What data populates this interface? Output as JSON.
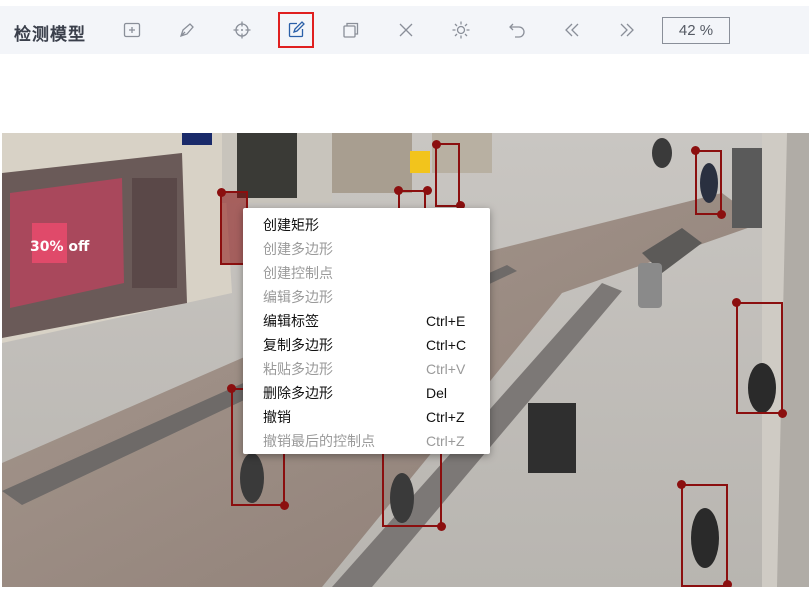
{
  "toolbar": {
    "title": "检测模型",
    "zoom": "42 %",
    "tools": [
      {
        "name": "add-box-icon",
        "active": false
      },
      {
        "name": "pen-icon",
        "active": false
      },
      {
        "name": "crosshair-icon",
        "active": false
      },
      {
        "name": "edit-icon",
        "active": true
      },
      {
        "name": "copy-icon",
        "active": false
      },
      {
        "name": "close-icon",
        "active": false
      },
      {
        "name": "brightness-icon",
        "active": false
      },
      {
        "name": "undo-icon",
        "active": false
      },
      {
        "name": "prev-icon",
        "active": false
      },
      {
        "name": "next-icon",
        "active": false
      }
    ]
  },
  "context_menu": {
    "items": [
      {
        "label": "创建矩形",
        "shortcut": "",
        "enabled": true
      },
      {
        "label": "创建多边形",
        "shortcut": "",
        "enabled": false
      },
      {
        "label": "创建控制点",
        "shortcut": "",
        "enabled": false
      },
      {
        "label": "编辑多边形",
        "shortcut": "",
        "enabled": false
      },
      {
        "label": "编辑标签",
        "shortcut": "Ctrl+E",
        "enabled": true
      },
      {
        "label": "复制多边形",
        "shortcut": "Ctrl+C",
        "enabled": true
      },
      {
        "label": "粘贴多边形",
        "shortcut": "Ctrl+V",
        "enabled": false
      },
      {
        "label": "删除多边形",
        "shortcut": "Del",
        "enabled": true
      },
      {
        "label": "撤销",
        "shortcut": "Ctrl+Z",
        "enabled": true
      },
      {
        "label": "撤销最后的控制点",
        "shortcut": "Ctrl+Z",
        "enabled": false
      }
    ]
  },
  "scene_text": {
    "shop_sign": "30% off"
  },
  "colors": {
    "toolbar_bg": "#f3f5f9",
    "bbox": "#8b0f0f",
    "active_tool_border": "#e02020"
  }
}
